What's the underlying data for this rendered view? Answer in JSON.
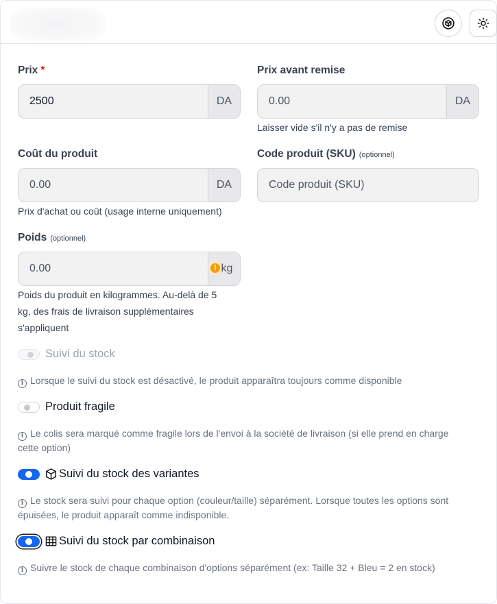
{
  "header": {
    "icons": [
      "package-icon",
      "sun-icon"
    ]
  },
  "price": {
    "label": "Prix",
    "required_mark": "*",
    "value": "2500",
    "suffix": "DA"
  },
  "compare_price": {
    "label": "Prix avant remise",
    "placeholder": "0.00",
    "suffix": "DA",
    "help": "Laisser vide s'il n'y a pas de remise"
  },
  "cost": {
    "label": "Coût du produit",
    "placeholder": "0.00",
    "suffix": "DA",
    "help": "Prix d'achat ou coût (usage interne uniquement)"
  },
  "sku": {
    "label": "Code produit (SKU)",
    "optional": "(optionnel)",
    "placeholder": "Code produit (SKU)"
  },
  "weight": {
    "label": "Poids",
    "optional": "(optionnel)",
    "placeholder": "0.00",
    "suffix": "kg",
    "help_lines": [
      "Poids du produit en kilogrammes. Au-delà de 5",
      "kg, des frais de livraison supplémentaires",
      "s'appliquent"
    ]
  },
  "toggles": {
    "stock_tracking": {
      "label": "Suivi du stock",
      "state": "disabled",
      "info": "Lorsque le suivi du stock est désactivé, le produit apparaîtra toujours comme disponible"
    },
    "fragile": {
      "label": "Produit fragile",
      "state": "off",
      "info_lines": [
        "Le colis sera marqué comme fragile lors de l'envoi à la société de livraison (si elle prend en charge",
        "cette option)"
      ]
    },
    "variant_stock": {
      "label": "Suivi du stock des variantes",
      "icon": "cube-icon",
      "state": "on",
      "info_lines": [
        "Le stock sera suivi pour chaque option (couleur/taille) séparément. Lorsque toutes les options sont",
        "épuisées, le produit apparaît comme indisponible."
      ]
    },
    "combination_stock": {
      "label": "Suivi du stock par combinaison",
      "icon": "grid-icon",
      "state": "on",
      "info": "Suivre le stock de chaque combinaison d'options séparément (ex: Taille 32 + Bleu = 2 en stock)"
    }
  },
  "colors": {
    "accent": "#1366f0",
    "required": "#dc2626",
    "warning": "#f59e0b"
  }
}
